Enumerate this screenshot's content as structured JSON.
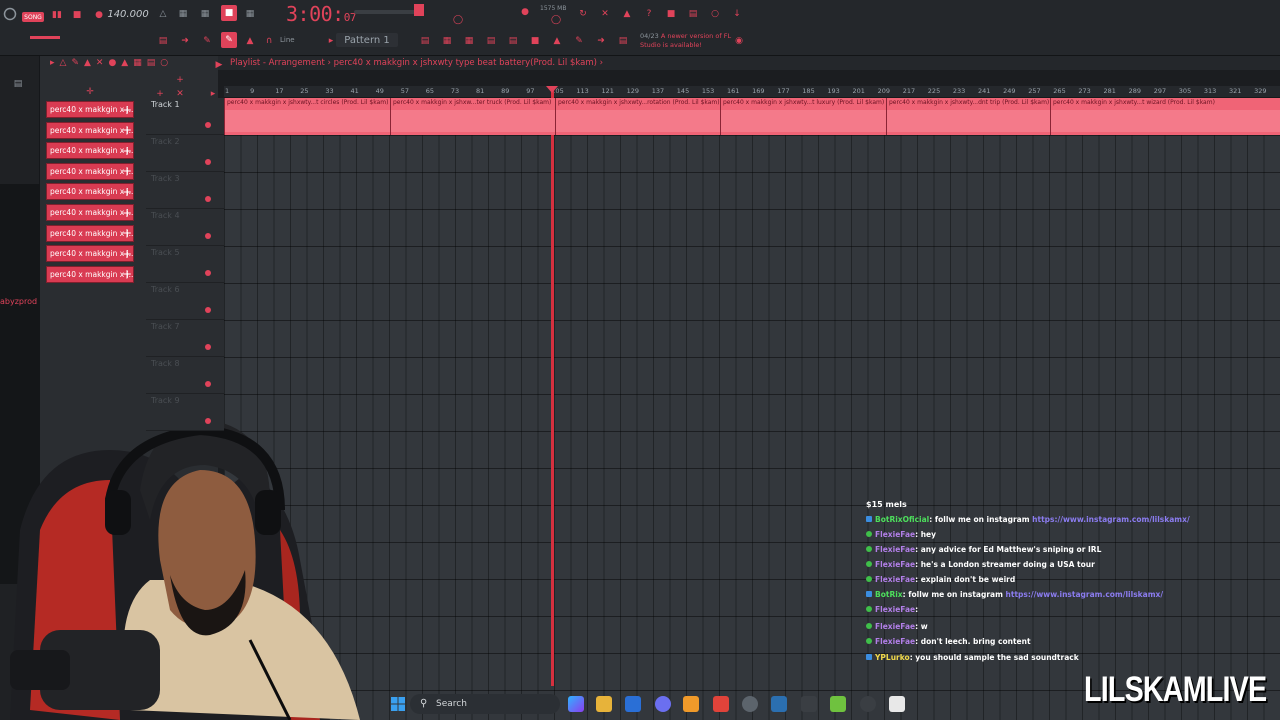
{
  "app": {
    "tempo": "140.000",
    "time_main": "3:00:",
    "time_sub": "07",
    "memory": "1575 MB",
    "song_button": "SONG",
    "pattern": "Pattern 1",
    "snap_label": "Line",
    "notice_title": "04/23",
    "notice_text": "A newer version of FL Studio is available!"
  },
  "playlist": {
    "title": "Playlist - Arrangement",
    "breadcrumb": "perc40 x makkgin x jshxwty type beat battery(Prod. Lil $kam)",
    "ruler_ticks": [
      "1",
      "9",
      "17",
      "25",
      "33",
      "41",
      "49",
      "57",
      "65",
      "73",
      "81",
      "89",
      "97",
      "105",
      "113",
      "121",
      "129",
      "137",
      "145",
      "153",
      "161",
      "169",
      "177",
      "185",
      "193",
      "201",
      "209",
      "217",
      "225",
      "233",
      "241",
      "249",
      "257",
      "265",
      "273",
      "281",
      "289",
      "297",
      "305",
      "313",
      "321",
      "329"
    ],
    "tracks": [
      {
        "name": "Track 1"
      },
      {
        "name": "Track 2"
      },
      {
        "name": "Track 3"
      },
      {
        "name": "Track 4"
      },
      {
        "name": "Track 5"
      },
      {
        "name": "Track 6"
      },
      {
        "name": "Track 7"
      },
      {
        "name": "Track 8"
      },
      {
        "name": "Track 9"
      }
    ],
    "clips": [
      {
        "label": "perc40 x makkgin x jshxwty...t circles (Prod. Lil $kam)"
      },
      {
        "label": "perc40 x makkgin x jshxw...ter truck (Prod. Lil $kam)"
      },
      {
        "label": "perc40 x makkgin x jshxwty...rotation (Prod. Lil $kam)"
      },
      {
        "label": "perc40 x makkgin x jshxwty...t luxury (Prod. Lil $kam)"
      },
      {
        "label": "perc40 x makkgin x jshxwty...dnt trip (Prod. Lil $kam)"
      },
      {
        "label": "perc40 x makkgin x jshxwty...t wizard (Prod. Lil $kam)"
      }
    ]
  },
  "browser": {
    "items": [
      {
        "label": "perc40 x makkgin x j..."
      },
      {
        "label": "perc40 x makkgin x j..."
      },
      {
        "label": "perc40 x makkgin x j..."
      },
      {
        "label": "perc40 x makkgin x j..."
      },
      {
        "label": "perc40 x makkgin x j..."
      },
      {
        "label": "perc40 x makkgin x j..."
      },
      {
        "label": "perc40 x makkgin x j..."
      },
      {
        "label": "perc40 x makkgin x j..."
      },
      {
        "label": "perc40 x makkgin x j..."
      }
    ],
    "side_label": "abyzprod"
  },
  "chat": {
    "title": "$15 mels",
    "messages": [
      {
        "user": "BotRixOficial",
        "text": ": follw me on instagram ",
        "link": "https://www.instagram.com/lilskamx/"
      },
      {
        "user": "FlexieFae",
        "text": ": hey",
        "link": ""
      },
      {
        "user": "FlexieFae",
        "text": ": any advice for Ed Matthew's sniping or IRL",
        "link": ""
      },
      {
        "user": "FlexieFae",
        "text": ": he's a London streamer doing a USA tour",
        "link": ""
      },
      {
        "user": "FlexieFae",
        "text": ": explain don't be weird",
        "link": ""
      },
      {
        "user": "BotRix",
        "text": ": follw me on instagram ",
        "link": "https://www.instagram.com/lilskamx/"
      },
      {
        "user": "FlexieFae",
        "text": ":",
        "link": ""
      },
      {
        "user": "FlexieFae",
        "text": ": w",
        "link": ""
      },
      {
        "user": "FlexieFae",
        "text": ": don't leech. bring content",
        "link": ""
      },
      {
        "user": "YPLurko",
        "text": ": you should sample the sad",
        "link": "",
        "extra": "soundtrack"
      }
    ]
  },
  "taskbar": {
    "search_label": "Search"
  },
  "watermark": "LILSKAMLIVE",
  "colors": {
    "accent": "#e0435a",
    "clip": "#f06476",
    "background": "#1b1d20"
  }
}
